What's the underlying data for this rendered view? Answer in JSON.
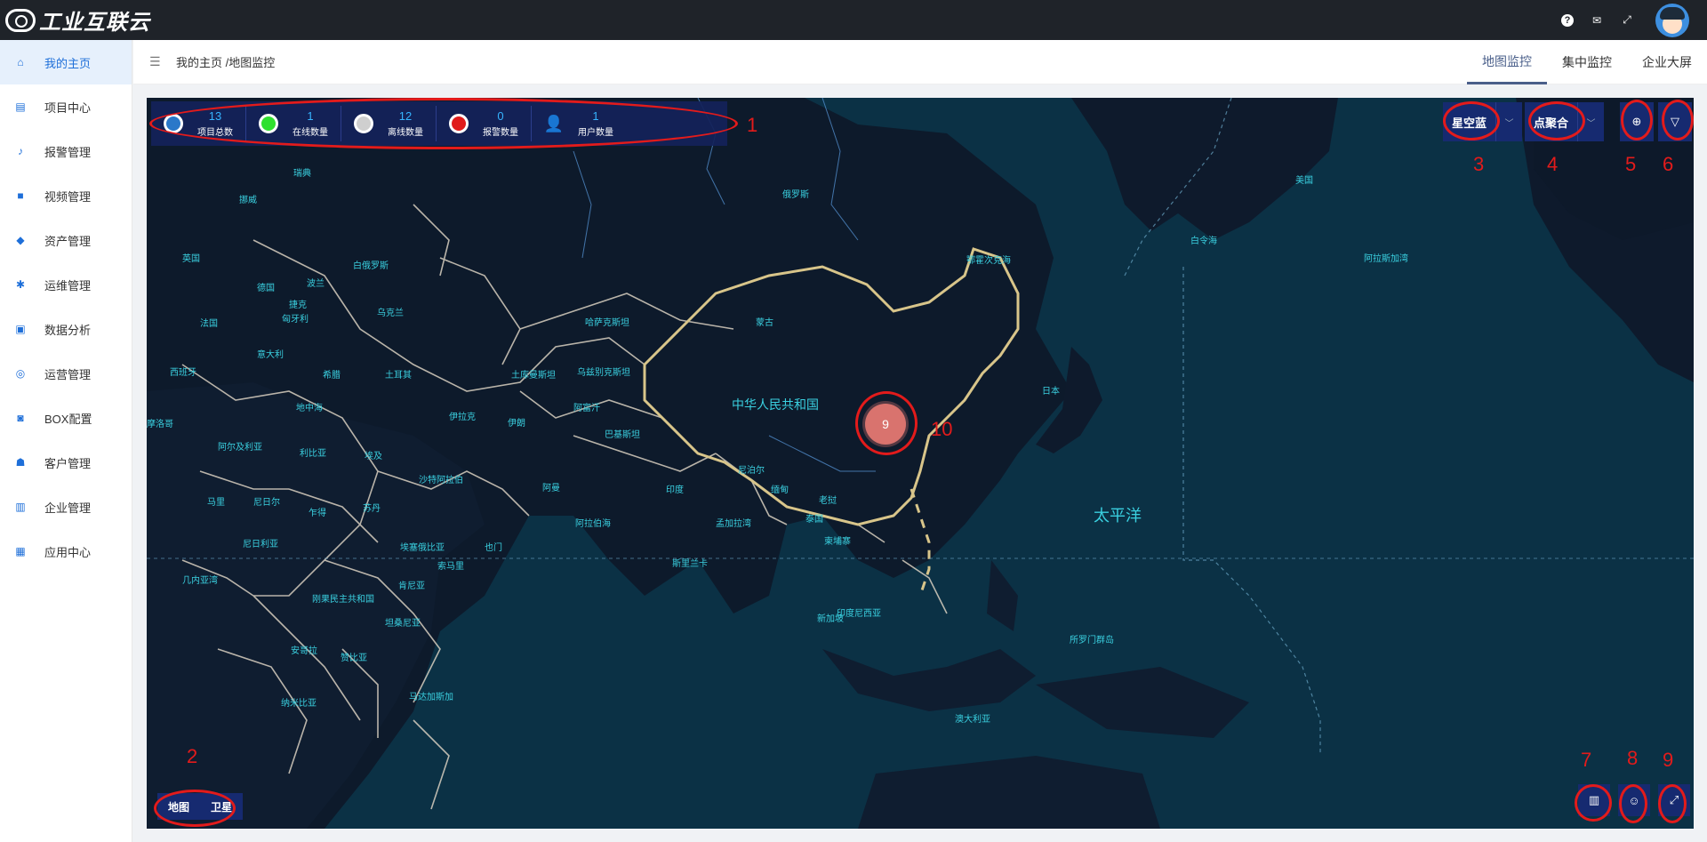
{
  "app": {
    "logo_text": "工业互联云"
  },
  "header_icons": [
    {
      "name": "help-icon",
      "glyph": "?"
    },
    {
      "name": "mail-icon",
      "glyph": "✉"
    },
    {
      "name": "fullscreen-icon",
      "glyph": "⤢"
    }
  ],
  "sidebar": {
    "items": [
      {
        "label": "我的主页",
        "icon": "home-icon",
        "glyph": "⌂",
        "active": true
      },
      {
        "label": "项目中心",
        "icon": "project-icon",
        "glyph": "▤"
      },
      {
        "label": "报警管理",
        "icon": "bell-icon",
        "glyph": "♪"
      },
      {
        "label": "视频管理",
        "icon": "video-icon",
        "glyph": "■"
      },
      {
        "label": "资产管理",
        "icon": "asset-icon",
        "glyph": "◆"
      },
      {
        "label": "运维管理",
        "icon": "gear-icon",
        "glyph": "✱"
      },
      {
        "label": "数据分析",
        "icon": "chart-icon",
        "glyph": "▣"
      },
      {
        "label": "运营管理",
        "icon": "operate-icon",
        "glyph": "◎"
      },
      {
        "label": "BOX配置",
        "icon": "box-icon",
        "glyph": "◙"
      },
      {
        "label": "客户管理",
        "icon": "users-icon",
        "glyph": "☗"
      },
      {
        "label": "企业管理",
        "icon": "briefcase-icon",
        "glyph": "▥"
      },
      {
        "label": "应用中心",
        "icon": "apps-icon",
        "glyph": "▦"
      }
    ]
  },
  "breadcrumb": "我的主页 /地图监控",
  "tabs": [
    {
      "label": "地图监控",
      "active": true
    },
    {
      "label": "集中监控"
    },
    {
      "label": "企业大屏"
    }
  ],
  "stats": [
    {
      "value": "13",
      "label": "项目总数",
      "color": "#2a78c9"
    },
    {
      "value": "1",
      "label": "在线数量",
      "color": "#2fe02f"
    },
    {
      "value": "12",
      "label": "离线数量",
      "color": "#cfcfcf"
    },
    {
      "value": "0",
      "label": "报警数量",
      "color": "#e01b1b"
    },
    {
      "value": "1",
      "label": "用户数量",
      "color": "user"
    }
  ],
  "controls": {
    "style_select": "星空蓝",
    "mode_select": "点聚合",
    "map_type": [
      "地图",
      "卫星"
    ]
  },
  "cluster_count": "9",
  "map_labels": {
    "pacific": "太平洋",
    "china": "中华人民共和国",
    "russia": "俄罗斯",
    "mongolia": "蒙古",
    "kazakhstan": "哈萨克斯坦",
    "japan": "日本",
    "india": "印度",
    "arabian_sea": "阿拉伯海",
    "bay_of_bengal": "孟加拉湾",
    "okhotsk": "鄂霍次克海",
    "bering": "白令海",
    "alaska": "阿拉斯加湾",
    "usa": "美国",
    "indonesia": "印度尼西亚",
    "australia": "澳大利亚",
    "solomon": "所罗门群岛",
    "mediterranean": "地中海",
    "turkey": "土耳其",
    "iran": "伊朗",
    "saudi": "沙特阿拉伯",
    "egypt": "埃及",
    "libya": "利比亚",
    "algeria": "阿尔及利亚",
    "mali": "马里",
    "niger": "尼日尔",
    "chad": "乍得",
    "sudan": "苏丹",
    "ethiopia": "埃塞俄比亚",
    "somalia": "索马里",
    "drc": "刚果民主共和国",
    "tanzania": "坦桑尼亚",
    "angola": "安哥拉",
    "zambia": "赞比亚",
    "namibia": "纳米比亚",
    "madagascar": "马达加斯加",
    "gulf_guinea": "几内亚湾",
    "nigeria": "尼日利亚",
    "kenya": "肯尼亚",
    "ukraine": "乌克兰",
    "poland": "波兰",
    "germany": "德国",
    "france": "法国",
    "uk": "英国",
    "norway": "挪威",
    "sweden": "瑞典",
    "belarus": "白俄罗斯",
    "italy": "意大利",
    "spain": "西班牙",
    "morocco": "摩洛哥",
    "greece": "希腊",
    "iraq": "伊拉克",
    "afghanistan": "阿富汗",
    "pakistan": "巴基斯坦",
    "turkmenistan": "土库曼斯坦",
    "uzbekistan": "乌兹别克斯坦",
    "myanmar": "缅甸",
    "thailand": "泰国",
    "laos": "老挝",
    "cambodia": "柬埔寨",
    "sri_lanka": "斯里兰卡",
    "singapore": "新加坡",
    "nepal": "尼泊尔",
    "yemen": "也门",
    "oman": "阿曼",
    "czech": "捷克",
    "hungary": "匈牙利"
  },
  "annotations": [
    "1",
    "2",
    "3",
    "4",
    "5",
    "6",
    "7",
    "8",
    "9",
    "10"
  ],
  "colors": {
    "accent": "#1e6fd9",
    "map_bg": "#0a1727",
    "land": "#0f1f33",
    "border": "#d8cfc0",
    "china_border": "#d8c58a",
    "panel": "#162a70",
    "annotation": "#e31b1b"
  }
}
